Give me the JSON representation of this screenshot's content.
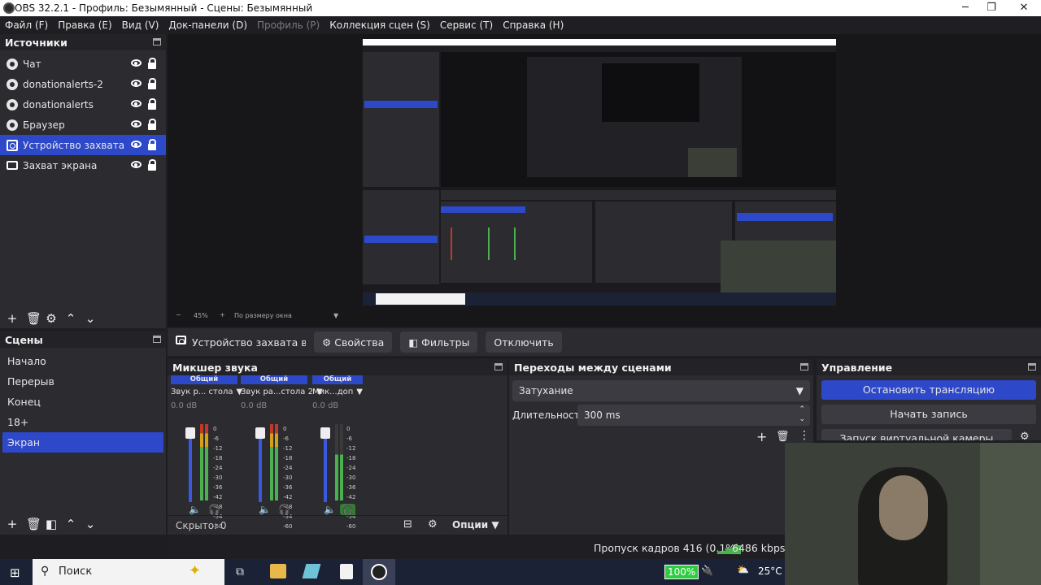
{
  "window": {
    "title": "OBS 32.2.1 - Профиль: Безымянный - Сцены: Безымянный",
    "minimize": "─",
    "maximize": "❐",
    "close": "✕"
  },
  "menu": [
    {
      "label": "Файл (F)",
      "enabled": true
    },
    {
      "label": "Правка (E)",
      "enabled": true
    },
    {
      "label": "Вид (V)",
      "enabled": true
    },
    {
      "label": "Док-панели (D)",
      "enabled": true
    },
    {
      "label": "Профиль (P)",
      "enabled": false
    },
    {
      "label": "Коллекция сцен (S)",
      "enabled": true
    },
    {
      "label": "Сервис (T)",
      "enabled": true
    },
    {
      "label": "Справка (H)",
      "enabled": true
    }
  ],
  "sources": {
    "title": "Источники",
    "items": [
      {
        "label": "Чат",
        "icon": "globe-icon"
      },
      {
        "label": "donationalerts-2",
        "icon": "globe-icon"
      },
      {
        "label": "donationalerts",
        "icon": "globe-icon"
      },
      {
        "label": "Браузер",
        "icon": "globe-icon"
      },
      {
        "label": "Устройство захвата видео",
        "icon": "camera-icon",
        "selected": true
      },
      {
        "label": "Захват экрана",
        "icon": "monitor-icon"
      }
    ]
  },
  "scenes": {
    "title": "Сцены",
    "items": [
      {
        "label": "Начало"
      },
      {
        "label": "Перерыв"
      },
      {
        "label": "Конец"
      },
      {
        "label": "18+"
      },
      {
        "label": "Экран",
        "selected": true
      }
    ]
  },
  "preview": {
    "zoom": "45%",
    "zoom_minus": "−",
    "zoom_plus": "+",
    "fit": "По размеру окна"
  },
  "source_toolbar": {
    "source_name": "Устройство захвата видео",
    "properties": "Свойства",
    "filters": "Фильтры",
    "deactivate": "Отключить"
  },
  "mixer": {
    "title": "Микшер звука",
    "channels": [
      {
        "group": "Общий",
        "name": "Звук р... стола",
        "db": "0.0 dB",
        "level": 0.55,
        "muted": false
      },
      {
        "group": "Общий",
        "name": "Звук ра...стола 2",
        "db": "0.0 dB",
        "level": 0.9,
        "muted": false
      },
      {
        "group": "Общий",
        "name": "Мик...доп",
        "db": "0.0 dB",
        "level": 0.1,
        "muted": false,
        "monitor_active": true
      }
    ],
    "ticks": [
      "0",
      "-6",
      "-12",
      "-18",
      "-24",
      "-30",
      "-36",
      "-42",
      "-48",
      "-54",
      "-60"
    ],
    "hidden": "Скрыто: 0",
    "options": "Опции"
  },
  "transitions": {
    "title": "Переходы между сценами",
    "selected": "Затухание",
    "duration_label": "Длительность",
    "duration": "300 ms"
  },
  "controls": {
    "title": "Управление",
    "stop_stream": "Остановить трансляцию",
    "start_record": "Начать запись",
    "virtual_cam": "Запуск виртуальной камеры"
  },
  "status": {
    "dropped_frames": "Пропуск кадров 416 (0.1%)",
    "bitrate": "6486 kbps"
  },
  "taskbar": {
    "search_placeholder": "Поиск",
    "battery": "100%",
    "temperature": "25°C"
  },
  "colors": {
    "accent": "#2d48c9",
    "panel": "#2b2b30",
    "background": "#1e1e22",
    "meter_green": "#4caf50"
  }
}
